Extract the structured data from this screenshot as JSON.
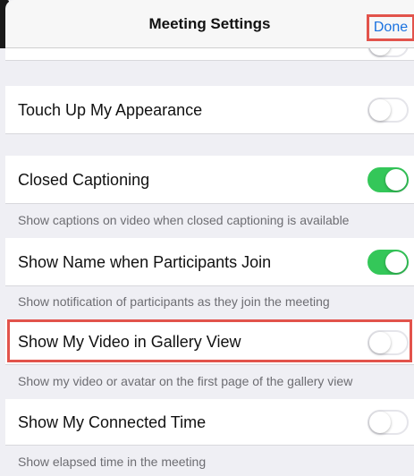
{
  "nav": {
    "title": "Meeting Settings",
    "done_label": "Done"
  },
  "settings": [
    {
      "label": "Touch Up My Appearance",
      "on": false,
      "desc": ""
    },
    {
      "label": "Closed Captioning",
      "on": true,
      "desc": "Show captions on video when closed captioning is available"
    },
    {
      "label": "Show Name when Participants Join",
      "on": true,
      "desc": "Show notification of participants as they join the meeting"
    },
    {
      "label": "Show My Video in Gallery View",
      "on": false,
      "desc": "Show my video or avatar on the first page of the gallery view"
    },
    {
      "label": "Show My Connected Time",
      "on": false,
      "desc": "Show elapsed time in the meeting"
    }
  ],
  "colors": {
    "accent": "#1a72e0",
    "toggle_on": "#34c759",
    "highlight": "#e2534b"
  }
}
